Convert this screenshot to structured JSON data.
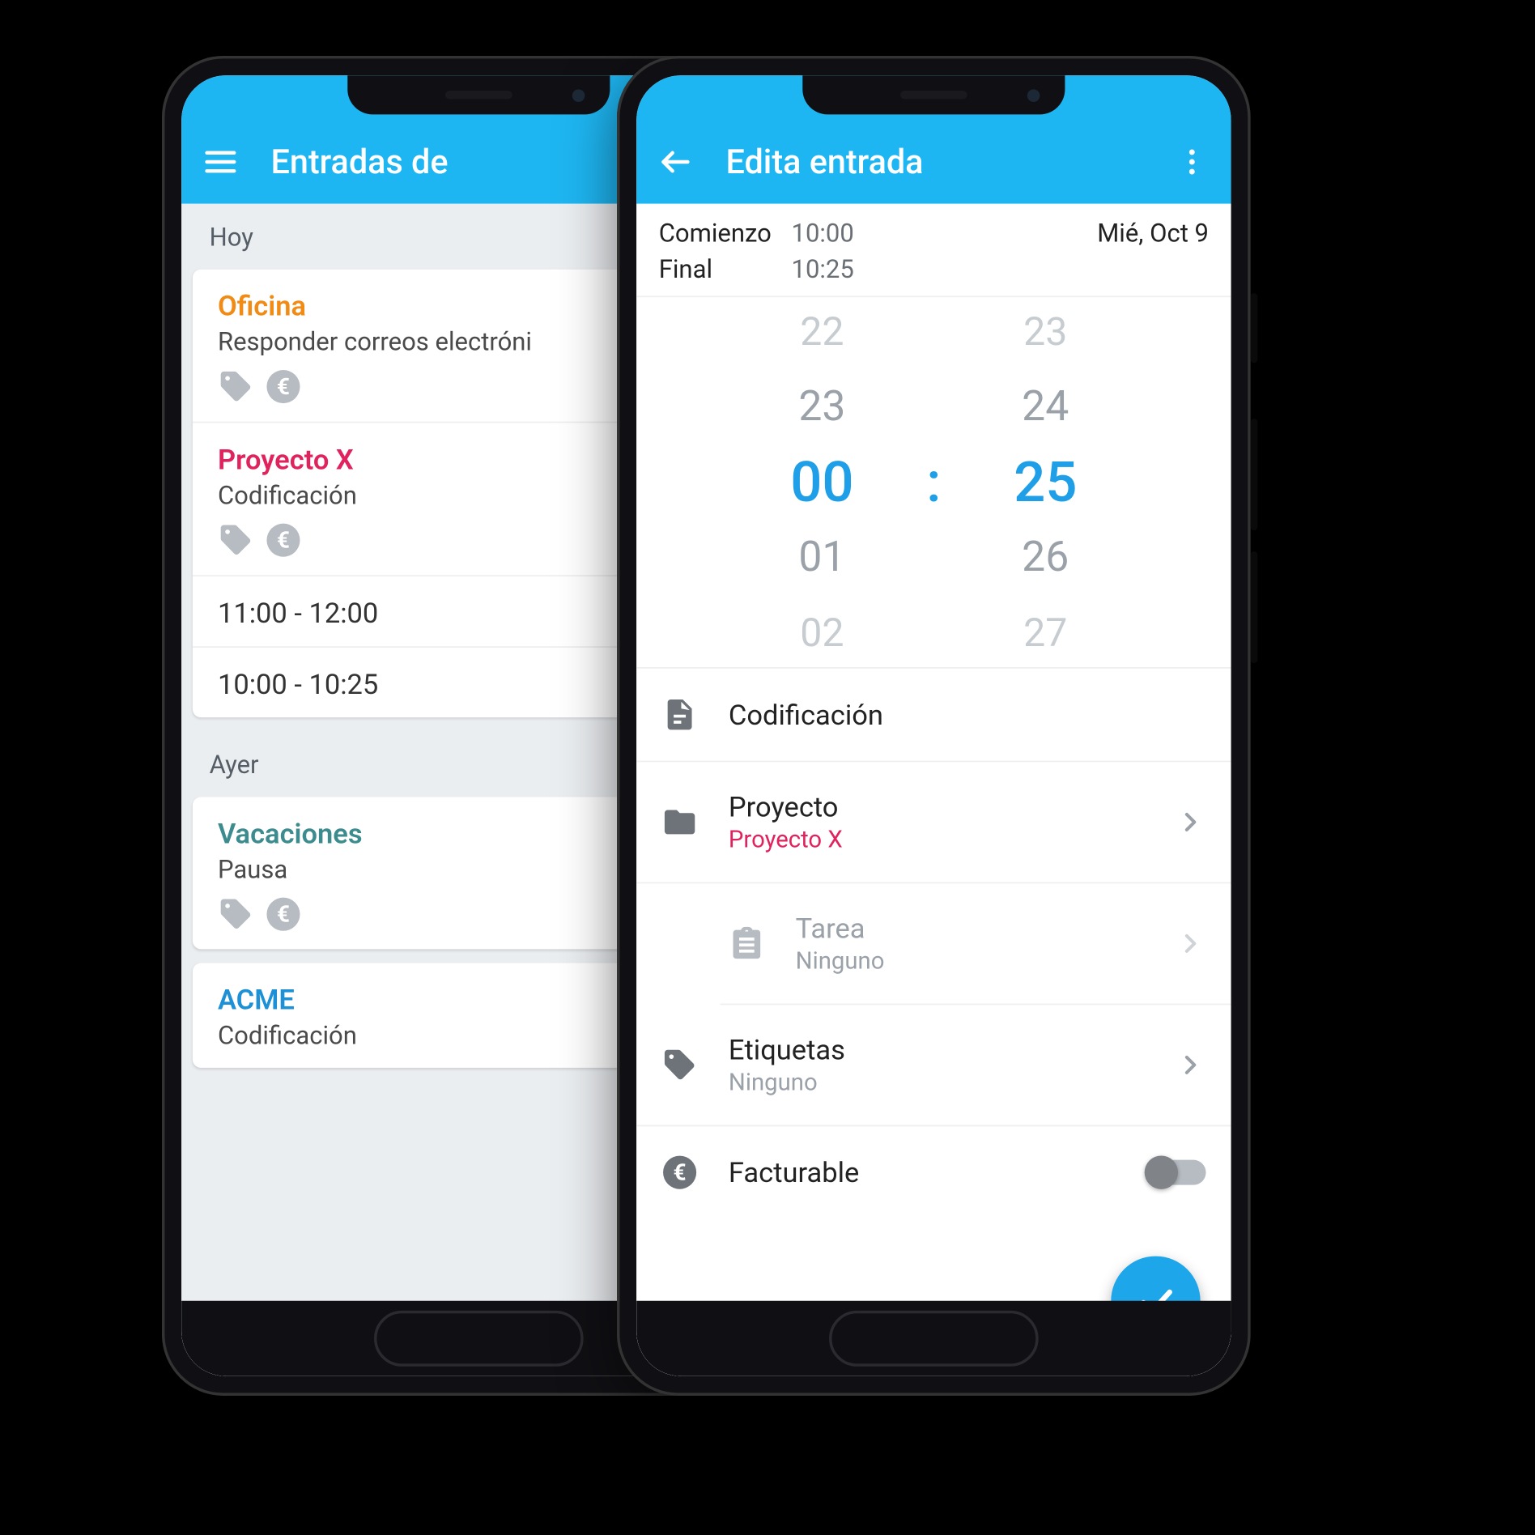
{
  "phone1": {
    "appbar": {
      "title": "Entradas de"
    },
    "sections": [
      {
        "header": "Hoy",
        "entries": [
          {
            "title": "Oficina",
            "color": "c-orange",
            "sub": "Responder correos electróni"
          },
          {
            "title": "Proyecto X",
            "color": "c-pink",
            "sub": "Codificación"
          }
        ],
        "times": [
          "11:00 - 12:00",
          "10:00 - 10:25"
        ]
      },
      {
        "header": "Ayer",
        "entries": [
          {
            "title": "Vacaciones",
            "color": "c-teal",
            "sub": "Pausa"
          }
        ],
        "extra_entry": {
          "title": "ACME",
          "color": "c-blue",
          "sub": "Codificación"
        }
      }
    ]
  },
  "phone2": {
    "appbar": {
      "title": "Edita entrada"
    },
    "start_label": "Comienzo",
    "end_label": "Final",
    "start_time": "10:00",
    "end_time": "10:25",
    "date": "Mié, Oct 9",
    "picker": {
      "hours": [
        "22",
        "23",
        "00",
        "01",
        "02"
      ],
      "minutes": [
        "23",
        "24",
        "25",
        "26",
        "27"
      ],
      "selected_hour": "00",
      "selected_minute": "25"
    },
    "note": "Codificación",
    "project_label": "Proyecto",
    "project_value": "Proyecto X",
    "task_label": "Tarea",
    "task_value": "Ninguno",
    "tags_label": "Etiquetas",
    "tags_value": "Ninguno",
    "billable_label": "Facturable"
  }
}
